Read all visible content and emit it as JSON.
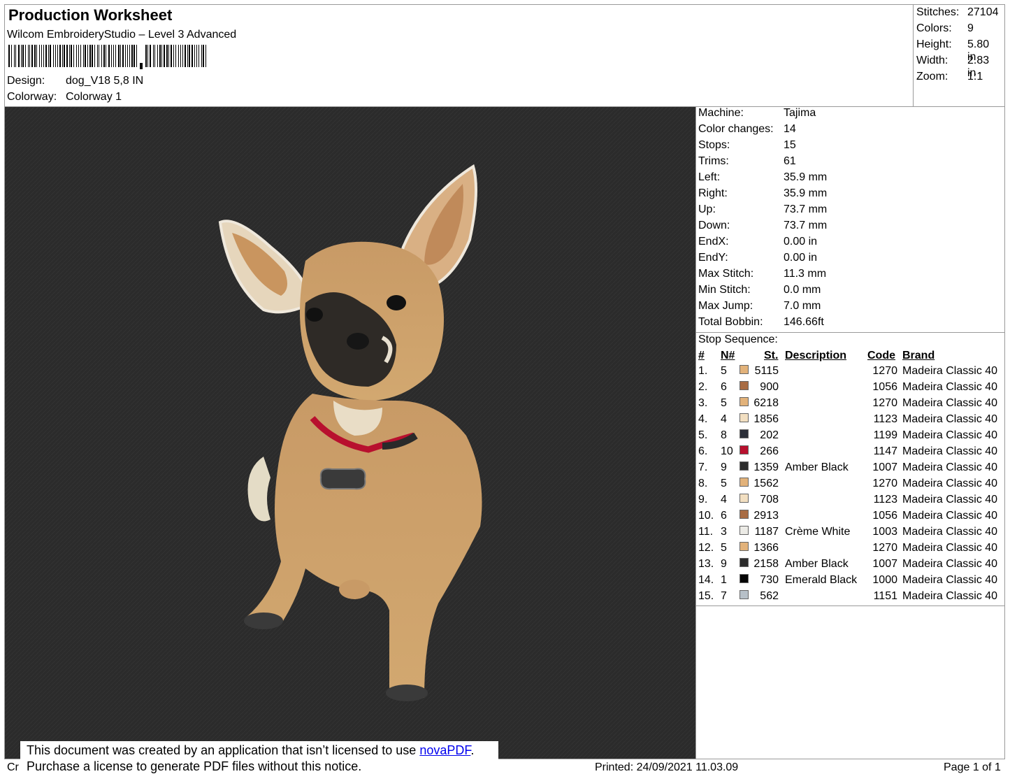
{
  "header": {
    "title": "Production Worksheet",
    "subtitle": "Wilcom EmbroideryStudio – Level 3 Advanced",
    "design_label": "Design:",
    "design_value": "dog_V18 5,8 IN",
    "colorway_label": "Colorway:",
    "colorway_value": "Colorway 1"
  },
  "stats": [
    {
      "label": "Stitches:",
      "value": "27104"
    },
    {
      "label": "Colors:",
      "value": "9"
    },
    {
      "label": "Height:",
      "value": "5.80 in"
    },
    {
      "label": "Width:",
      "value": "2.83 in"
    },
    {
      "label": "Zoom:",
      "value": "1:1"
    }
  ],
  "machine_info": [
    {
      "label": "Machine:",
      "value": "Tajima"
    },
    {
      "label": "Color changes:",
      "value": "14"
    },
    {
      "label": "Stops:",
      "value": "15"
    },
    {
      "label": "Trims:",
      "value": "61"
    },
    {
      "label": "Left:",
      "value": "35.9 mm"
    },
    {
      "label": "Right:",
      "value": "35.9 mm"
    },
    {
      "label": "Up:",
      "value": "73.7 mm"
    },
    {
      "label": "Down:",
      "value": "73.7 mm"
    },
    {
      "label": "EndX:",
      "value": "0.00 in"
    },
    {
      "label": "EndY:",
      "value": "0.00 in"
    },
    {
      "label": "Max Stitch:",
      "value": "11.3 mm"
    },
    {
      "label": "Min Stitch:",
      "value": "0.0 mm"
    },
    {
      "label": "Max Jump:",
      "value": "7.0 mm"
    },
    {
      "label": "Total Bobbin:",
      "value": "146.66ft"
    }
  ],
  "stop_sequence": {
    "title": "Stop Sequence:",
    "headers": {
      "num": "#",
      "n": "N#",
      "st": "St.",
      "description": "Description",
      "code": "Code",
      "brand": "Brand"
    },
    "rows": [
      {
        "num": "1.",
        "n": "5",
        "color": "#e2b27a",
        "st": "5115",
        "description": "",
        "code": "1270",
        "brand": "Madeira Classic 40"
      },
      {
        "num": "2.",
        "n": "6",
        "color": "#a86c44",
        "st": "900",
        "description": "",
        "code": "1056",
        "brand": "Madeira Classic 40"
      },
      {
        "num": "3.",
        "n": "5",
        "color": "#e2b27a",
        "st": "6218",
        "description": "",
        "code": "1270",
        "brand": "Madeira Classic 40"
      },
      {
        "num": "4.",
        "n": "4",
        "color": "#f2dfc1",
        "st": "1856",
        "description": "",
        "code": "1123",
        "brand": "Madeira Classic 40"
      },
      {
        "num": "5.",
        "n": "8",
        "color": "#2b2e38",
        "st": "202",
        "description": "",
        "code": "1199",
        "brand": "Madeira Classic 40"
      },
      {
        "num": "6.",
        "n": "10",
        "color": "#b8102e",
        "st": "266",
        "description": "",
        "code": "1147",
        "brand": "Madeira Classic 40"
      },
      {
        "num": "7.",
        "n": "9",
        "color": "#2c2c2c",
        "st": "1359",
        "description": "Amber Black",
        "code": "1007",
        "brand": "Madeira Classic 40"
      },
      {
        "num": "8.",
        "n": "5",
        "color": "#e2b27a",
        "st": "1562",
        "description": "",
        "code": "1270",
        "brand": "Madeira Classic 40"
      },
      {
        "num": "9.",
        "n": "4",
        "color": "#f2dfc1",
        "st": "708",
        "description": "",
        "code": "1123",
        "brand": "Madeira Classic 40"
      },
      {
        "num": "10.",
        "n": "6",
        "color": "#a86c44",
        "st": "2913",
        "description": "",
        "code": "1056",
        "brand": "Madeira Classic 40"
      },
      {
        "num": "11.",
        "n": "3",
        "color": "#ecebe6",
        "st": "1187",
        "description": "Crème White",
        "code": "1003",
        "brand": "Madeira Classic 40"
      },
      {
        "num": "12.",
        "n": "5",
        "color": "#e2b27a",
        "st": "1366",
        "description": "",
        "code": "1270",
        "brand": "Madeira Classic 40"
      },
      {
        "num": "13.",
        "n": "9",
        "color": "#2c2c2c",
        "st": "2158",
        "description": "Amber Black",
        "code": "1007",
        "brand": "Madeira Classic 40"
      },
      {
        "num": "14.",
        "n": "1",
        "color": "#050505",
        "st": "730",
        "description": "Emerald Black",
        "code": "1000",
        "brand": "Madeira Classic 40"
      },
      {
        "num": "15.",
        "n": "7",
        "color": "#b7c0c8",
        "st": "562",
        "description": "",
        "code": "1151",
        "brand": "Madeira Classic 40"
      }
    ]
  },
  "notice": {
    "line1_prefix": "This document was created by an application that isn’t licensed to use ",
    "link": "novaPDF",
    "line1_suffix": ".",
    "line2": "Purchase a license to generate PDF files without this notice."
  },
  "footer": {
    "cr": "Cr",
    "printed": "Printed: 24/09/2021 11.03.09",
    "page": "Page 1 of 1"
  }
}
